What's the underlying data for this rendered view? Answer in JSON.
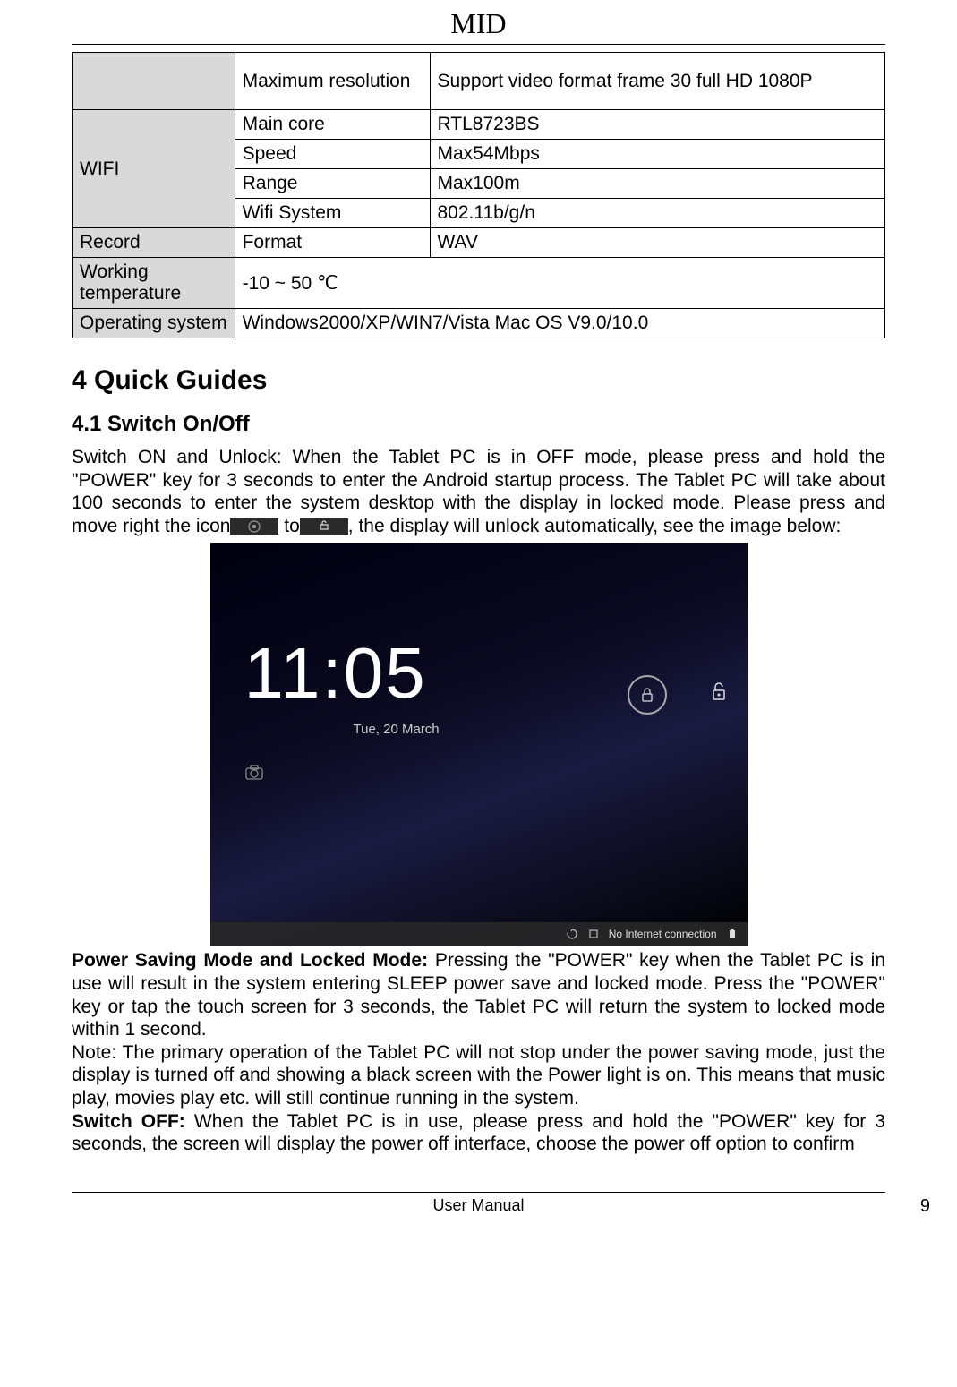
{
  "header": {
    "title": "MID"
  },
  "spec_table": {
    "rows": [
      {
        "cat": "",
        "key": "Maximum resolution",
        "val": "Support video format frame 30 full HD 1080P",
        "tall": true,
        "catBlank": true
      },
      {
        "cat": "WIFI",
        "key": "Main core",
        "val": "RTL8723BS",
        "rowspan": 4
      },
      {
        "key": "Speed",
        "val": "Max54Mbps"
      },
      {
        "key": "Range",
        "val": "Max100m"
      },
      {
        "key": "Wifi System",
        "val": "802.11b/g/n"
      },
      {
        "cat": "Record",
        "key": "Format",
        "val": "WAV"
      },
      {
        "cat": "Working temperature",
        "val": "-10    ~ 50  ℃",
        "span2": true
      },
      {
        "cat": "Operating system",
        "val": "Windows2000/XP/WIN7/Vista    Mac OS V9.0/10.0",
        "span2": true
      }
    ]
  },
  "sections": {
    "quick_guides": "4 Quick Guides",
    "switch_onoff": "4.1 Switch On/Off"
  },
  "content": {
    "switch_on_part1": "Switch ON and Unlock: When the Tablet PC is in OFF mode, please press and hold the \"POWER\" key for 3 seconds to enter the Android startup process. The Tablet PC will take about 100 seconds to enter the system desktop with the display in locked mode. Please press and move right the icon",
    "switch_on_mid": " to",
    "switch_on_part2": ", the display will unlock automatically, see the image below:",
    "power_saving_label": "Power Saving Mode and Locked Mode: ",
    "power_saving_text": "Pressing the \"POWER\" key when the Tablet PC is in use will result in the system entering SLEEP power save and locked mode. Press the \"POWER\" key or tap the touch screen for 3 seconds, the Tablet PC will return the system to locked mode within 1 second.",
    "note_text": "Note: The primary operation of the Tablet PC will not stop under the power saving mode, just the display is turned off and showing a black screen with the Power light is on. This means that music play, movies play etc. will still continue running in the system.",
    "switch_off_label": "Switch OFF: ",
    "switch_off_text": "When the Tablet PC is in use, please press and hold the \"POWER\" key for 3 seconds, the screen will display the power off interface, choose the power off option to confirm"
  },
  "lockscreen": {
    "time": "11:05",
    "date": "Tue, 20 March",
    "status_text": "No Internet connection"
  },
  "footer": {
    "center": "User Manual",
    "page": "9"
  }
}
